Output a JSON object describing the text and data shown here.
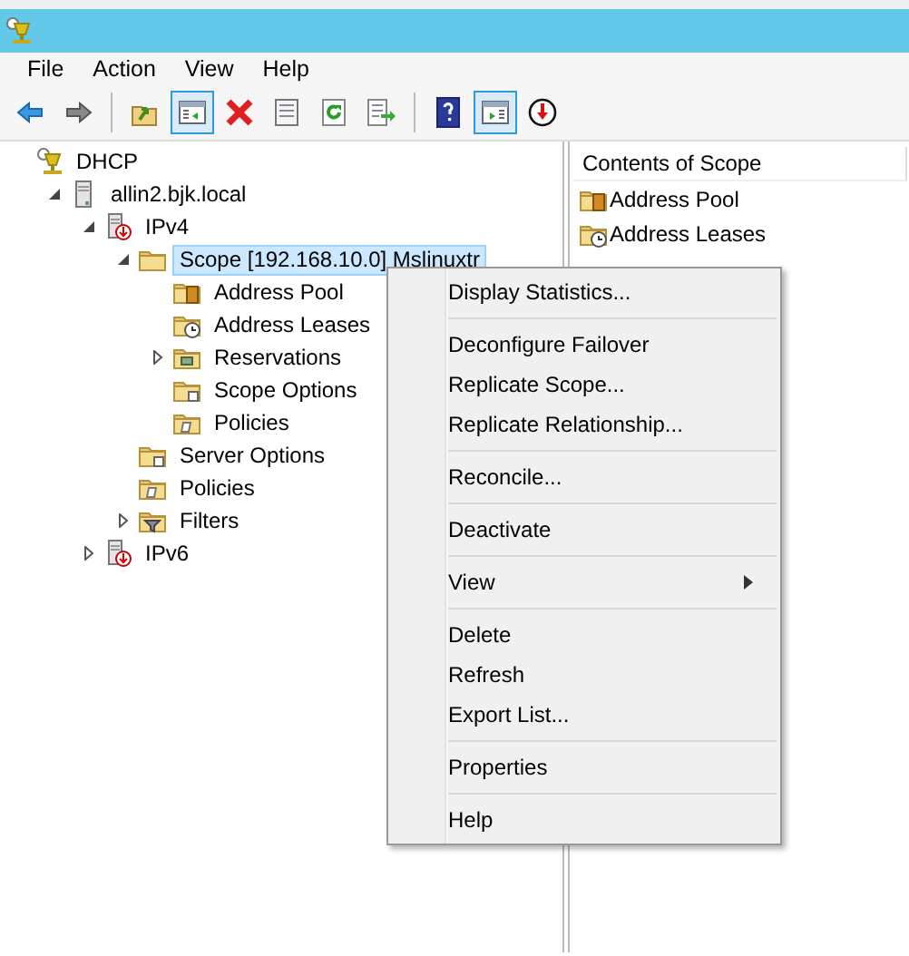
{
  "menubar": [
    "File",
    "Action",
    "View",
    "Help"
  ],
  "toolbar": [
    {
      "kind": "back",
      "pressed": false
    },
    {
      "kind": "forward",
      "pressed": false
    },
    {
      "kind": "separator"
    },
    {
      "kind": "up",
      "pressed": false
    },
    {
      "kind": "console-tree",
      "pressed": true
    },
    {
      "kind": "delete",
      "pressed": false
    },
    {
      "kind": "properties",
      "pressed": false
    },
    {
      "kind": "refresh",
      "pressed": false
    },
    {
      "kind": "export",
      "pressed": false
    },
    {
      "kind": "separator"
    },
    {
      "kind": "help",
      "pressed": false
    },
    {
      "kind": "action-pane",
      "pressed": true
    },
    {
      "kind": "down",
      "pressed": false
    }
  ],
  "tree": [
    {
      "label": "DHCP",
      "kind": "dhcp",
      "selected": false,
      "children": [
        {
          "label": "allin2.bjk.local",
          "kind": "server",
          "selected": false,
          "expanded": true,
          "children": [
            {
              "label": "IPv4",
              "kind": "ip",
              "selected": false,
              "expanded": true,
              "children": [
                {
                  "label": "Scope [192.168.10.0] Mslinuxtr",
                  "kind": "folder",
                  "selected": true,
                  "expanded": true,
                  "children": [
                    {
                      "label": "Address Pool",
                      "kind": "pool",
                      "selected": false
                    },
                    {
                      "label": "Address Leases",
                      "kind": "leases",
                      "selected": false
                    },
                    {
                      "label": "Reservations",
                      "kind": "reservations",
                      "selected": false,
                      "expanded": false
                    },
                    {
                      "label": "Scope Options",
                      "kind": "options",
                      "selected": false
                    },
                    {
                      "label": "Policies",
                      "kind": "policies",
                      "selected": false
                    }
                  ]
                },
                {
                  "label": "Server Options",
                  "kind": "options",
                  "selected": false
                },
                {
                  "label": "Policies",
                  "kind": "policies",
                  "selected": false
                },
                {
                  "label": "Filters",
                  "kind": "filters",
                  "selected": false,
                  "expanded": false
                }
              ]
            },
            {
              "label": "IPv6",
              "kind": "ip",
              "selected": false,
              "expanded": false
            }
          ]
        }
      ]
    }
  ],
  "contents": {
    "header": "Contents of Scope",
    "items": [
      {
        "label": "Address Pool",
        "kind": "pool"
      },
      {
        "label": "Address Leases",
        "kind": "leases"
      }
    ]
  },
  "context_menu": {
    "groups": [
      [
        {
          "label": "Display Statistics...",
          "submenu": false
        }
      ],
      [
        {
          "label": "Deconfigure Failover",
          "submenu": false
        },
        {
          "label": "Replicate Scope...",
          "submenu": false
        },
        {
          "label": "Replicate Relationship...",
          "submenu": false
        }
      ],
      [
        {
          "label": "Reconcile...",
          "submenu": false
        }
      ],
      [
        {
          "label": "Deactivate",
          "submenu": false
        }
      ],
      [
        {
          "label": "View",
          "submenu": true
        }
      ],
      [
        {
          "label": "Delete",
          "submenu": false
        },
        {
          "label": "Refresh",
          "submenu": false
        },
        {
          "label": "Export List...",
          "submenu": false
        }
      ],
      [
        {
          "label": "Properties",
          "submenu": false
        }
      ],
      [
        {
          "label": "Help",
          "submenu": false
        }
      ]
    ]
  }
}
